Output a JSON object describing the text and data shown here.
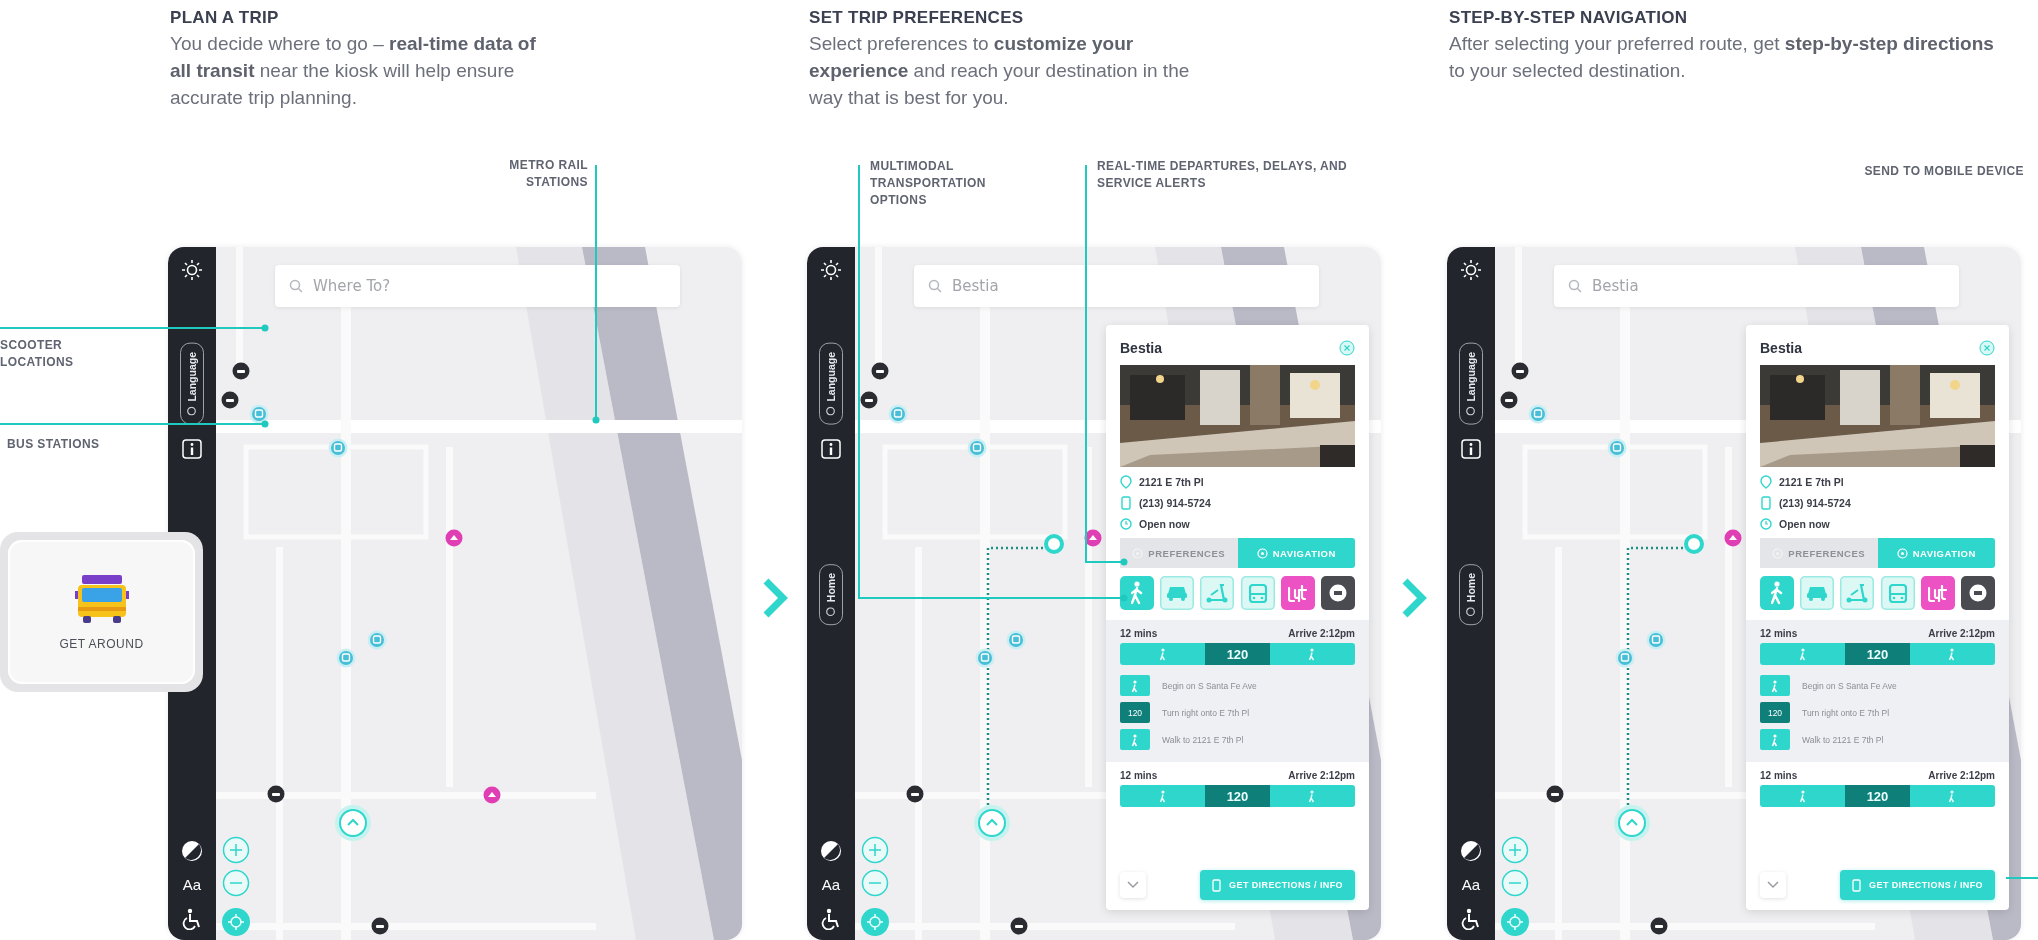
{
  "panels": [
    {
      "title": "PLAN A TRIP",
      "description": "You decide where to go – **real-time data of all transit** near the kiosk will help ensure accurate trip planning.",
      "callouts": [
        {
          "text": "METRO RAIL STATIONS"
        },
        {
          "text": "SCOOTER LOCATIONS"
        },
        {
          "text": "BUS STATIONS"
        }
      ],
      "screen": {
        "search": {
          "placeholder": "Where To?"
        },
        "sidebar": {
          "buttons": [
            {
              "kind": "language",
              "label": "Language"
            }
          ],
          "text_size_glyph": "Aa"
        }
      }
    },
    {
      "title": "SET TRIP PREFERENCES",
      "description": "Select preferences to **customize your experience** and reach your destination in the way that is best for you.",
      "callouts": [
        {
          "text": "MULTIMODAL TRANSPORTATION OPTIONS"
        },
        {
          "text": "REAL-TIME DEPARTURES, DELAYS, AND SERVICE ALERTS"
        }
      ],
      "screen": {
        "search": {
          "value": "Bestia"
        },
        "sidebar": {
          "buttons": [
            {
              "kind": "language",
              "label": "Language"
            },
            {
              "kind": "home",
              "label": "Home"
            }
          ],
          "text_size_glyph": "Aa"
        },
        "route_shown": true,
        "place_card": {
          "name": "Bestia",
          "details": [
            {
              "kind": "address",
              "text": "2121 E 7th Pl"
            },
            {
              "kind": "phone",
              "text": "(213) 914-5724"
            },
            {
              "kind": "hours",
              "text": "Open now"
            }
          ],
          "tabs": [
            {
              "label": "PREFERENCES",
              "selected": false
            },
            {
              "label": "NAVIGATION",
              "selected": true
            }
          ],
          "modes": [
            {
              "kind": "walk",
              "selected": true
            },
            {
              "kind": "car",
              "selected": false
            },
            {
              "kind": "scooter",
              "selected": false
            },
            {
              "kind": "bus",
              "selected": false
            },
            {
              "kind": "lyft",
              "selected": false
            },
            {
              "kind": "uber",
              "selected": false
            }
          ],
          "routes": [
            {
              "duration": "12 mins",
              "arrival": "Arrive 2:12pm",
              "expanded": true,
              "legs": [
                {
                  "kind": "walk"
                },
                {
                  "kind": "bus",
                  "label": "120"
                },
                {
                  "kind": "walk"
                }
              ],
              "steps": [
                {
                  "kind": "walk",
                  "text": "Begin on S Santa Fe Ave"
                },
                {
                  "kind": "bus",
                  "label": "120",
                  "text": "Turn right onto E 7th Pl"
                },
                {
                  "kind": "walk",
                  "text": "Walk to 2121 E 7th Pl"
                }
              ]
            },
            {
              "duration": "12 mins",
              "arrival": "Arrive 2:12pm",
              "expanded": false,
              "legs": [
                {
                  "kind": "walk"
                },
                {
                  "kind": "bus",
                  "label": "120"
                },
                {
                  "kind": "walk"
                }
              ]
            }
          ],
          "action_button": {
            "label": "GET DIRECTIONS / INFO"
          }
        }
      }
    },
    {
      "title": "STEP-BY-STEP NAVIGATION",
      "description": "After selecting your preferred route, get **step-by-step directions** to your selected destination.",
      "callouts": [
        {
          "text": "SEND TO MOBILE DEVICE"
        }
      ],
      "screen": {
        "search": {
          "value": "Bestia"
        },
        "sidebar": {
          "buttons": [
            {
              "kind": "language",
              "label": "Language"
            },
            {
              "kind": "home",
              "label": "Home"
            }
          ],
          "text_size_glyph": "Aa"
        },
        "route_shown": true,
        "place_card": {
          "name": "Bestia",
          "details": [
            {
              "kind": "address",
              "text": "2121 E 7th Pl"
            },
            {
              "kind": "phone",
              "text": "(213) 914-5724"
            },
            {
              "kind": "hours",
              "text": "Open now"
            }
          ],
          "tabs": [
            {
              "label": "PREFERENCES",
              "selected": false
            },
            {
              "label": "NAVIGATION",
              "selected": true
            }
          ],
          "modes": [
            {
              "kind": "walk",
              "selected": true
            },
            {
              "kind": "car",
              "selected": false
            },
            {
              "kind": "scooter",
              "selected": false
            },
            {
              "kind": "bus",
              "selected": false
            },
            {
              "kind": "lyft",
              "selected": false
            },
            {
              "kind": "uber",
              "selected": false
            }
          ],
          "routes": [
            {
              "duration": "12 mins",
              "arrival": "Arrive 2:12pm",
              "expanded": true,
              "legs": [
                {
                  "kind": "walk"
                },
                {
                  "kind": "bus",
                  "label": "120"
                },
                {
                  "kind": "walk"
                }
              ],
              "steps": [
                {
                  "kind": "walk",
                  "text": "Begin on S Santa Fe Ave"
                },
                {
                  "kind": "bus",
                  "label": "120",
                  "text": "Turn right onto E 7th Pl"
                },
                {
                  "kind": "walk",
                  "text": "Walk to 2121 E 7th Pl"
                }
              ]
            },
            {
              "duration": "12 mins",
              "arrival": "Arrive 2:12pm",
              "expanded": false,
              "legs": [
                {
                  "kind": "walk"
                },
                {
                  "kind": "bus",
                  "label": "120"
                },
                {
                  "kind": "walk"
                }
              ]
            }
          ],
          "action_button": {
            "label": "GET DIRECTIONS / INFO"
          }
        }
      }
    }
  ],
  "promo_tile": {
    "label": "GET AROUND"
  }
}
